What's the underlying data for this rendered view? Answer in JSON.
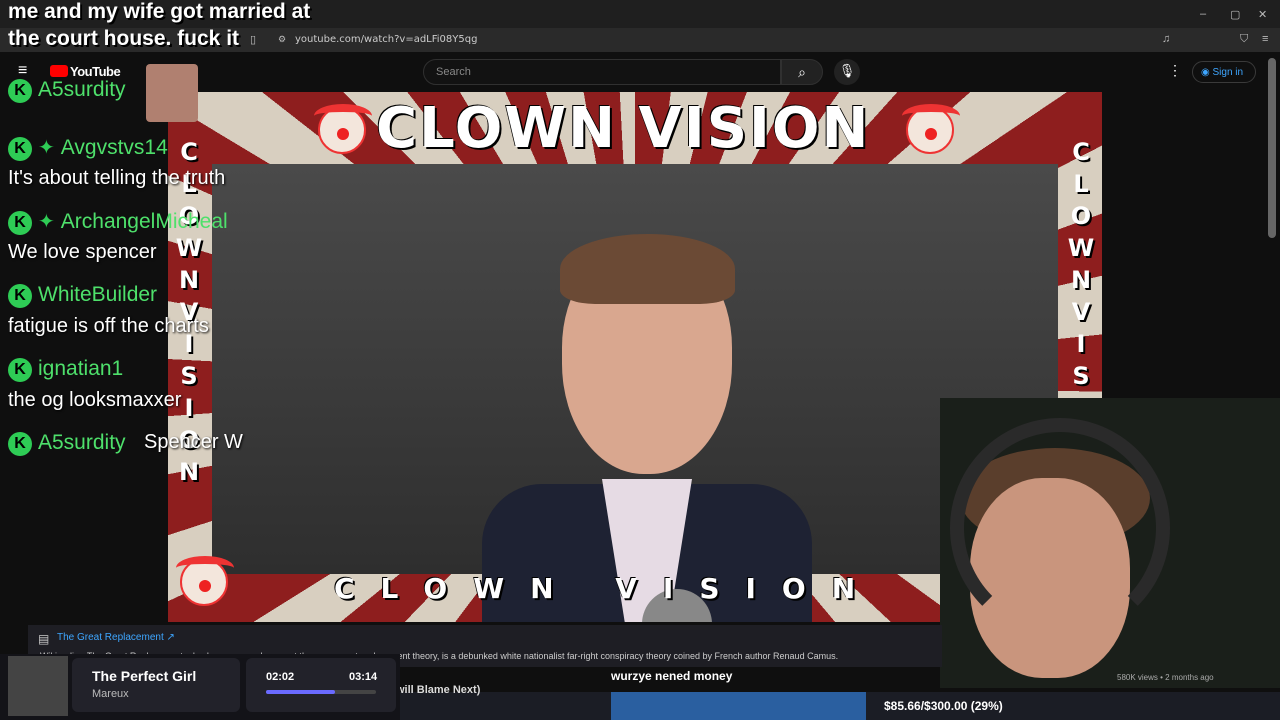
{
  "stream_title": "me and my wife got married at the court house. fuck it",
  "browser": {
    "url": "youtube.com/watch?v=adLFi08Y5qg"
  },
  "youtube": {
    "logo": "YouTube",
    "search_placeholder": "Search",
    "sign_in": "Sign in"
  },
  "video": {
    "banner_top": "CLOWN VISION",
    "banner_bottom": "CLOWN VISION",
    "vertical_left": [
      "C",
      "L",
      "O",
      "W",
      "N",
      "V",
      "I",
      "S",
      "I",
      "O",
      "N"
    ],
    "vertical_right": [
      "C",
      "L",
      "O",
      "W",
      "N",
      "V",
      "I",
      "S"
    ]
  },
  "chat": {
    "messages": [
      {
        "user": "A5surdity",
        "text": ""
      },
      {
        "user": "Avgvstvs14",
        "text": "It's about telling the truth"
      },
      {
        "user": "ArchangelMicheal",
        "text": "We love spencer"
      },
      {
        "user": "WhiteBuilder",
        "text": "fatigue is off the charts"
      },
      {
        "user": "ignatian1",
        "text": "the og looksmaxxer"
      },
      {
        "user": "A5surdity",
        "text": "Spencer W"
      }
    ]
  },
  "wiki": {
    "title": "The Great Replacement ↗",
    "text": "Wikipedia · The Great Replacement, also known as replacement theory or great replacement theory, is a debunked white nationalist far-right conspiracy theory coined by French author Renaud Camus."
  },
  "video_meta": "580K views • 2 months ago",
  "player": {
    "track": "The Perfect Girl",
    "artist": "Mareux",
    "current": "02:02",
    "total": "03:14",
    "progress": 0.63
  },
  "caption": "wurzye nened money",
  "subtitle_partial": "will Blame Next)",
  "goal": {
    "text": "$85.66/$300.00 (29%)",
    "fraction": 0.29
  }
}
